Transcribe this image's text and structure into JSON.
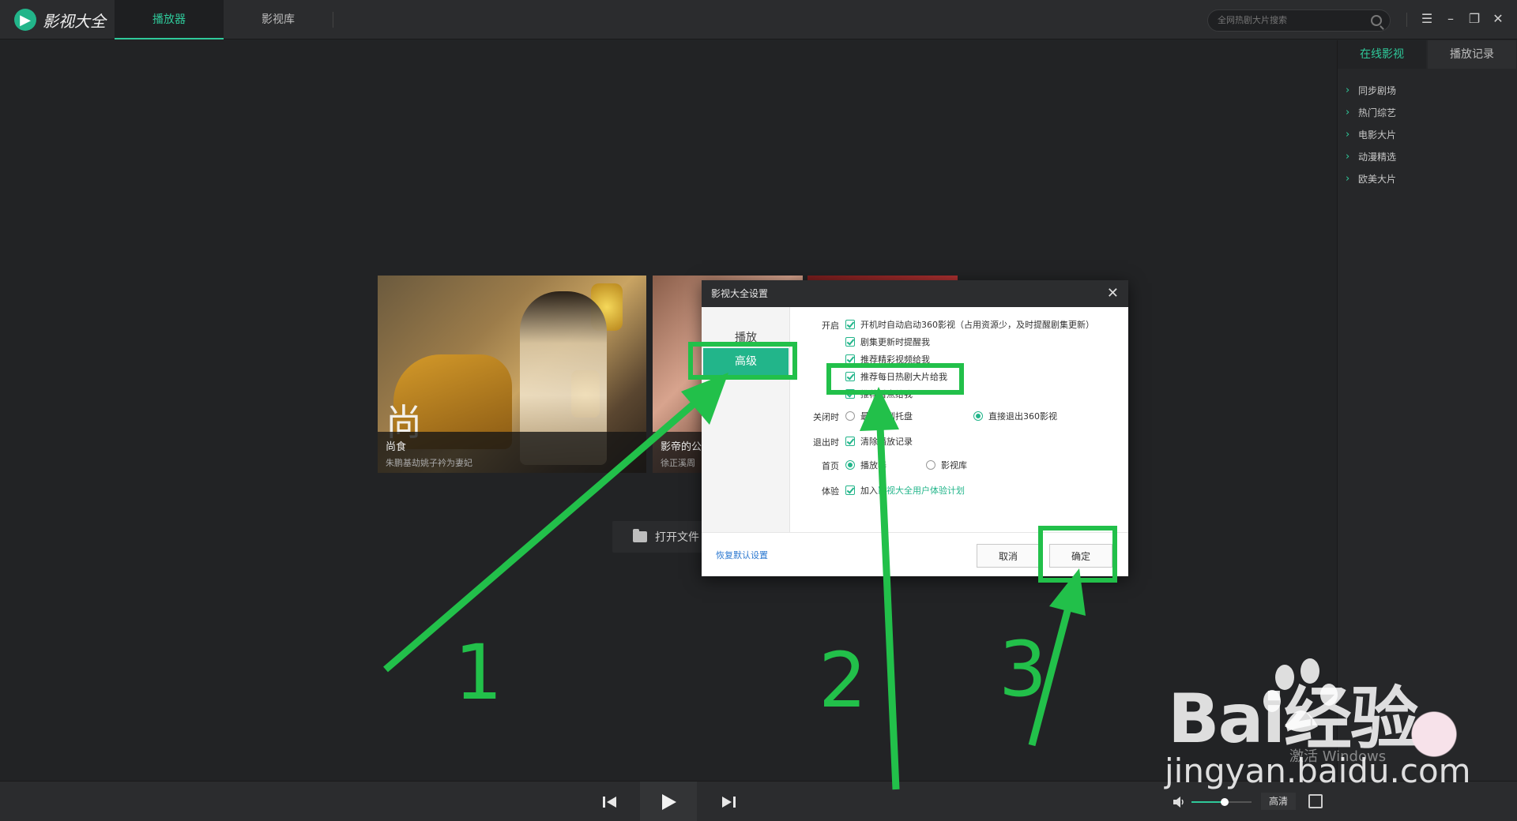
{
  "app": {
    "name": "影视大全",
    "tabs": [
      "播放器",
      "影视库"
    ],
    "search_placeholder": "全网热剧大片搜索"
  },
  "right_panel": {
    "tabs": [
      "在线影视",
      "播放记录"
    ],
    "items": [
      "同步剧场",
      "热门综艺",
      "电影大片",
      "动漫精选",
      "欧美大片"
    ]
  },
  "main": {
    "posters": [
      {
        "big_char": "尚",
        "title": "尚食",
        "subtitle": "朱鹏基劫姚子衿为妻妃"
      },
      {
        "title": "影帝的公",
        "subtitle": "徐正溪周"
      }
    ],
    "open_file_label": "打开文件"
  },
  "player": {
    "quality": "高清",
    "volume_fraction": 0.55
  },
  "dialog": {
    "title": "影视大全设置",
    "side_items": [
      "播放",
      "高级"
    ],
    "sections": {
      "startup_label": "开启",
      "startup_options": [
        "开机时自动启动360影视（占用资源少，及时提醒剧集更新）",
        "剧集更新时提醒我",
        "推荐精彩视频给我",
        "推荐每日热剧大片给我",
        "推荐看点给我"
      ],
      "close_label": "关闭时",
      "close_options": [
        "最小化到托盘",
        "直接退出360影视"
      ],
      "exit_label": "退出时",
      "exit_option": "清除播放记录",
      "home_label": "首页",
      "home_options": [
        "播放器",
        "影视库"
      ],
      "experience_label": "体验",
      "experience_prefix": "加入",
      "experience_link": "影视大全用户体验计划"
    },
    "restore_label": "恢复默认设置",
    "cancel_label": "取消",
    "ok_label": "确定"
  },
  "annotations": {
    "numbers": [
      "1",
      "2",
      "3"
    ],
    "color": "#22c04a"
  },
  "watermark": {
    "brand": "Bai经验",
    "url": "jingyan.baidu.com",
    "windows": "激活 Windows"
  },
  "colors": {
    "accent": "#22b58a",
    "background": "#222325"
  }
}
